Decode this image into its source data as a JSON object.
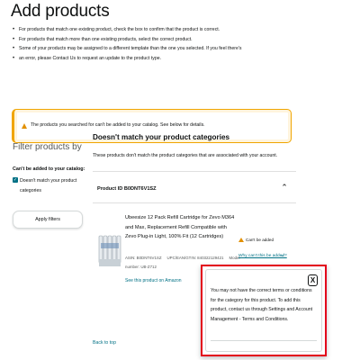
{
  "page": {
    "title": "Add products",
    "instructions": [
      "For products that match one existing product, check the box to confirm that the product is correct.",
      "For products that match more than one existing products, select the correct product.",
      "Some of your products may be assigned to a different template than the one you selected. If you feel there's",
      "an error, please Contact Us to request an update to the product type."
    ]
  },
  "alert": {
    "text": "The products you searched for can't be added to your catalog. See below for details.",
    "color": "#f0a500"
  },
  "filters": {
    "title": "Filter products by",
    "group_label": "Can't be added to your catalog:",
    "option_label": "Doesn't match your product categories",
    "option_checked": true,
    "apply_label": "Apply filters"
  },
  "section": {
    "title": "Doesn't match your product categories",
    "subtitle": "These products don't match the product categories that are associated with your account."
  },
  "product": {
    "id_label": "Product ID B0DNT6V1SZ",
    "name": "Ubeesize 12 Pack Refill Cartridge for Zevo M364 and Max, Replacement Refill Compatible with Zevo Plug-in Light, 100% Fit (12 Cartridges)",
    "asin": "ASIN: B0DNT6V1SZ",
    "upc": "UPC/EAN/GTIN: 840322129421",
    "model_label": "Model",
    "model_number": "number: UB-Z712",
    "see_listing": "See this product on Amazon",
    "status_text": "Can't be added",
    "why_link": "Why can't this be added?"
  },
  "popover": {
    "text": "You may not have the correct terms or conditions for the category for this product. To add this product, contact us through Settings and Account Management - Terms and Conditions.",
    "close_label": "X",
    "border_color": "#e3001b"
  },
  "footer": {
    "back_to_top": "Back to top"
  },
  "icons": {
    "alert": "warning-icon",
    "status": "warning-icon",
    "collapse": "chevron-up-icon",
    "why": "chevron-down-icon",
    "close": "close-icon",
    "checkbox": "check-icon"
  },
  "colors": {
    "link": "#007185",
    "warning": "#e29000",
    "text": "#0f1111"
  }
}
